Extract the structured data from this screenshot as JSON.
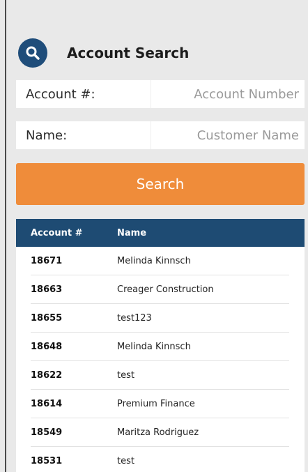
{
  "header": {
    "title": "Account Search",
    "icon": "search-icon"
  },
  "form": {
    "account": {
      "label": "Account #:",
      "value": "",
      "placeholder": "Account Number"
    },
    "name": {
      "label": "Name:",
      "value": "",
      "placeholder": "Customer Name"
    },
    "search_label": "Search"
  },
  "results": {
    "columns": [
      "Account #",
      "Name"
    ],
    "rows": [
      {
        "account": "18671",
        "name": "Melinda Kinnsch"
      },
      {
        "account": "18663",
        "name": "Creager Construction"
      },
      {
        "account": "18655",
        "name": "test123"
      },
      {
        "account": "18648",
        "name": "Melinda Kinnsch"
      },
      {
        "account": "18622",
        "name": "test"
      },
      {
        "account": "18614",
        "name": "Premium Finance"
      },
      {
        "account": "18549",
        "name": "Maritza Rodriguez"
      },
      {
        "account": "18531",
        "name": "test"
      }
    ]
  },
  "colors": {
    "accent": "#ef8c3a",
    "header": "#1e4b73",
    "icon_bg": "#1f4d7a",
    "background": "#e9e9e9"
  }
}
